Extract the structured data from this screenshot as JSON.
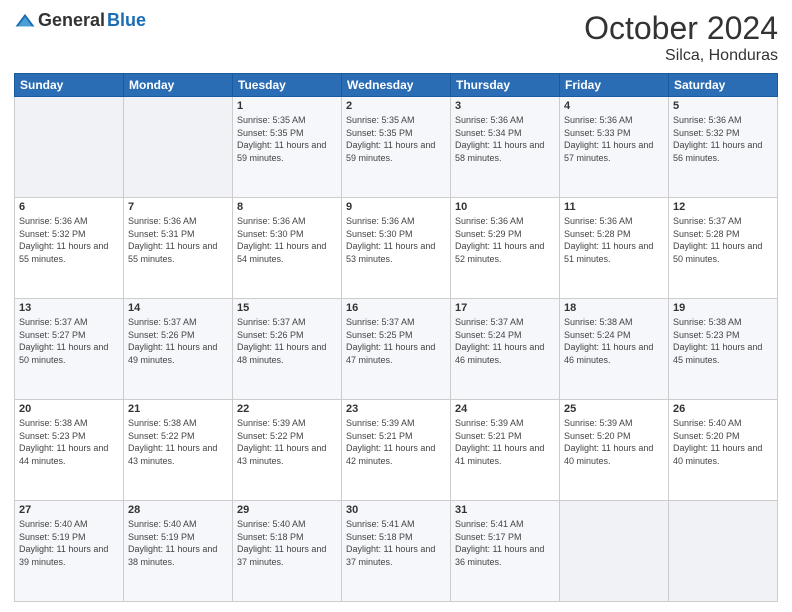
{
  "header": {
    "logo": {
      "general": "General",
      "blue": "Blue"
    },
    "title": "October 2024",
    "location": "Silca, Honduras"
  },
  "weekdays": [
    "Sunday",
    "Monday",
    "Tuesday",
    "Wednesday",
    "Thursday",
    "Friday",
    "Saturday"
  ],
  "weeks": [
    [
      {
        "day": "",
        "sunrise": "",
        "sunset": "",
        "daylight": ""
      },
      {
        "day": "",
        "sunrise": "",
        "sunset": "",
        "daylight": ""
      },
      {
        "day": "1",
        "sunrise": "Sunrise: 5:35 AM",
        "sunset": "Sunset: 5:35 PM",
        "daylight": "Daylight: 11 hours and 59 minutes."
      },
      {
        "day": "2",
        "sunrise": "Sunrise: 5:35 AM",
        "sunset": "Sunset: 5:35 PM",
        "daylight": "Daylight: 11 hours and 59 minutes."
      },
      {
        "day": "3",
        "sunrise": "Sunrise: 5:36 AM",
        "sunset": "Sunset: 5:34 PM",
        "daylight": "Daylight: 11 hours and 58 minutes."
      },
      {
        "day": "4",
        "sunrise": "Sunrise: 5:36 AM",
        "sunset": "Sunset: 5:33 PM",
        "daylight": "Daylight: 11 hours and 57 minutes."
      },
      {
        "day": "5",
        "sunrise": "Sunrise: 5:36 AM",
        "sunset": "Sunset: 5:32 PM",
        "daylight": "Daylight: 11 hours and 56 minutes."
      }
    ],
    [
      {
        "day": "6",
        "sunrise": "Sunrise: 5:36 AM",
        "sunset": "Sunset: 5:32 PM",
        "daylight": "Daylight: 11 hours and 55 minutes."
      },
      {
        "day": "7",
        "sunrise": "Sunrise: 5:36 AM",
        "sunset": "Sunset: 5:31 PM",
        "daylight": "Daylight: 11 hours and 55 minutes."
      },
      {
        "day": "8",
        "sunrise": "Sunrise: 5:36 AM",
        "sunset": "Sunset: 5:30 PM",
        "daylight": "Daylight: 11 hours and 54 minutes."
      },
      {
        "day": "9",
        "sunrise": "Sunrise: 5:36 AM",
        "sunset": "Sunset: 5:30 PM",
        "daylight": "Daylight: 11 hours and 53 minutes."
      },
      {
        "day": "10",
        "sunrise": "Sunrise: 5:36 AM",
        "sunset": "Sunset: 5:29 PM",
        "daylight": "Daylight: 11 hours and 52 minutes."
      },
      {
        "day": "11",
        "sunrise": "Sunrise: 5:36 AM",
        "sunset": "Sunset: 5:28 PM",
        "daylight": "Daylight: 11 hours and 51 minutes."
      },
      {
        "day": "12",
        "sunrise": "Sunrise: 5:37 AM",
        "sunset": "Sunset: 5:28 PM",
        "daylight": "Daylight: 11 hours and 50 minutes."
      }
    ],
    [
      {
        "day": "13",
        "sunrise": "Sunrise: 5:37 AM",
        "sunset": "Sunset: 5:27 PM",
        "daylight": "Daylight: 11 hours and 50 minutes."
      },
      {
        "day": "14",
        "sunrise": "Sunrise: 5:37 AM",
        "sunset": "Sunset: 5:26 PM",
        "daylight": "Daylight: 11 hours and 49 minutes."
      },
      {
        "day": "15",
        "sunrise": "Sunrise: 5:37 AM",
        "sunset": "Sunset: 5:26 PM",
        "daylight": "Daylight: 11 hours and 48 minutes."
      },
      {
        "day": "16",
        "sunrise": "Sunrise: 5:37 AM",
        "sunset": "Sunset: 5:25 PM",
        "daylight": "Daylight: 11 hours and 47 minutes."
      },
      {
        "day": "17",
        "sunrise": "Sunrise: 5:37 AM",
        "sunset": "Sunset: 5:24 PM",
        "daylight": "Daylight: 11 hours and 46 minutes."
      },
      {
        "day": "18",
        "sunrise": "Sunrise: 5:38 AM",
        "sunset": "Sunset: 5:24 PM",
        "daylight": "Daylight: 11 hours and 46 minutes."
      },
      {
        "day": "19",
        "sunrise": "Sunrise: 5:38 AM",
        "sunset": "Sunset: 5:23 PM",
        "daylight": "Daylight: 11 hours and 45 minutes."
      }
    ],
    [
      {
        "day": "20",
        "sunrise": "Sunrise: 5:38 AM",
        "sunset": "Sunset: 5:23 PM",
        "daylight": "Daylight: 11 hours and 44 minutes."
      },
      {
        "day": "21",
        "sunrise": "Sunrise: 5:38 AM",
        "sunset": "Sunset: 5:22 PM",
        "daylight": "Daylight: 11 hours and 43 minutes."
      },
      {
        "day": "22",
        "sunrise": "Sunrise: 5:39 AM",
        "sunset": "Sunset: 5:22 PM",
        "daylight": "Daylight: 11 hours and 43 minutes."
      },
      {
        "day": "23",
        "sunrise": "Sunrise: 5:39 AM",
        "sunset": "Sunset: 5:21 PM",
        "daylight": "Daylight: 11 hours and 42 minutes."
      },
      {
        "day": "24",
        "sunrise": "Sunrise: 5:39 AM",
        "sunset": "Sunset: 5:21 PM",
        "daylight": "Daylight: 11 hours and 41 minutes."
      },
      {
        "day": "25",
        "sunrise": "Sunrise: 5:39 AM",
        "sunset": "Sunset: 5:20 PM",
        "daylight": "Daylight: 11 hours and 40 minutes."
      },
      {
        "day": "26",
        "sunrise": "Sunrise: 5:40 AM",
        "sunset": "Sunset: 5:20 PM",
        "daylight": "Daylight: 11 hours and 40 minutes."
      }
    ],
    [
      {
        "day": "27",
        "sunrise": "Sunrise: 5:40 AM",
        "sunset": "Sunset: 5:19 PM",
        "daylight": "Daylight: 11 hours and 39 minutes."
      },
      {
        "day": "28",
        "sunrise": "Sunrise: 5:40 AM",
        "sunset": "Sunset: 5:19 PM",
        "daylight": "Daylight: 11 hours and 38 minutes."
      },
      {
        "day": "29",
        "sunrise": "Sunrise: 5:40 AM",
        "sunset": "Sunset: 5:18 PM",
        "daylight": "Daylight: 11 hours and 37 minutes."
      },
      {
        "day": "30",
        "sunrise": "Sunrise: 5:41 AM",
        "sunset": "Sunset: 5:18 PM",
        "daylight": "Daylight: 11 hours and 37 minutes."
      },
      {
        "day": "31",
        "sunrise": "Sunrise: 5:41 AM",
        "sunset": "Sunset: 5:17 PM",
        "daylight": "Daylight: 11 hours and 36 minutes."
      },
      {
        "day": "",
        "sunrise": "",
        "sunset": "",
        "daylight": ""
      },
      {
        "day": "",
        "sunrise": "",
        "sunset": "",
        "daylight": ""
      }
    ]
  ]
}
